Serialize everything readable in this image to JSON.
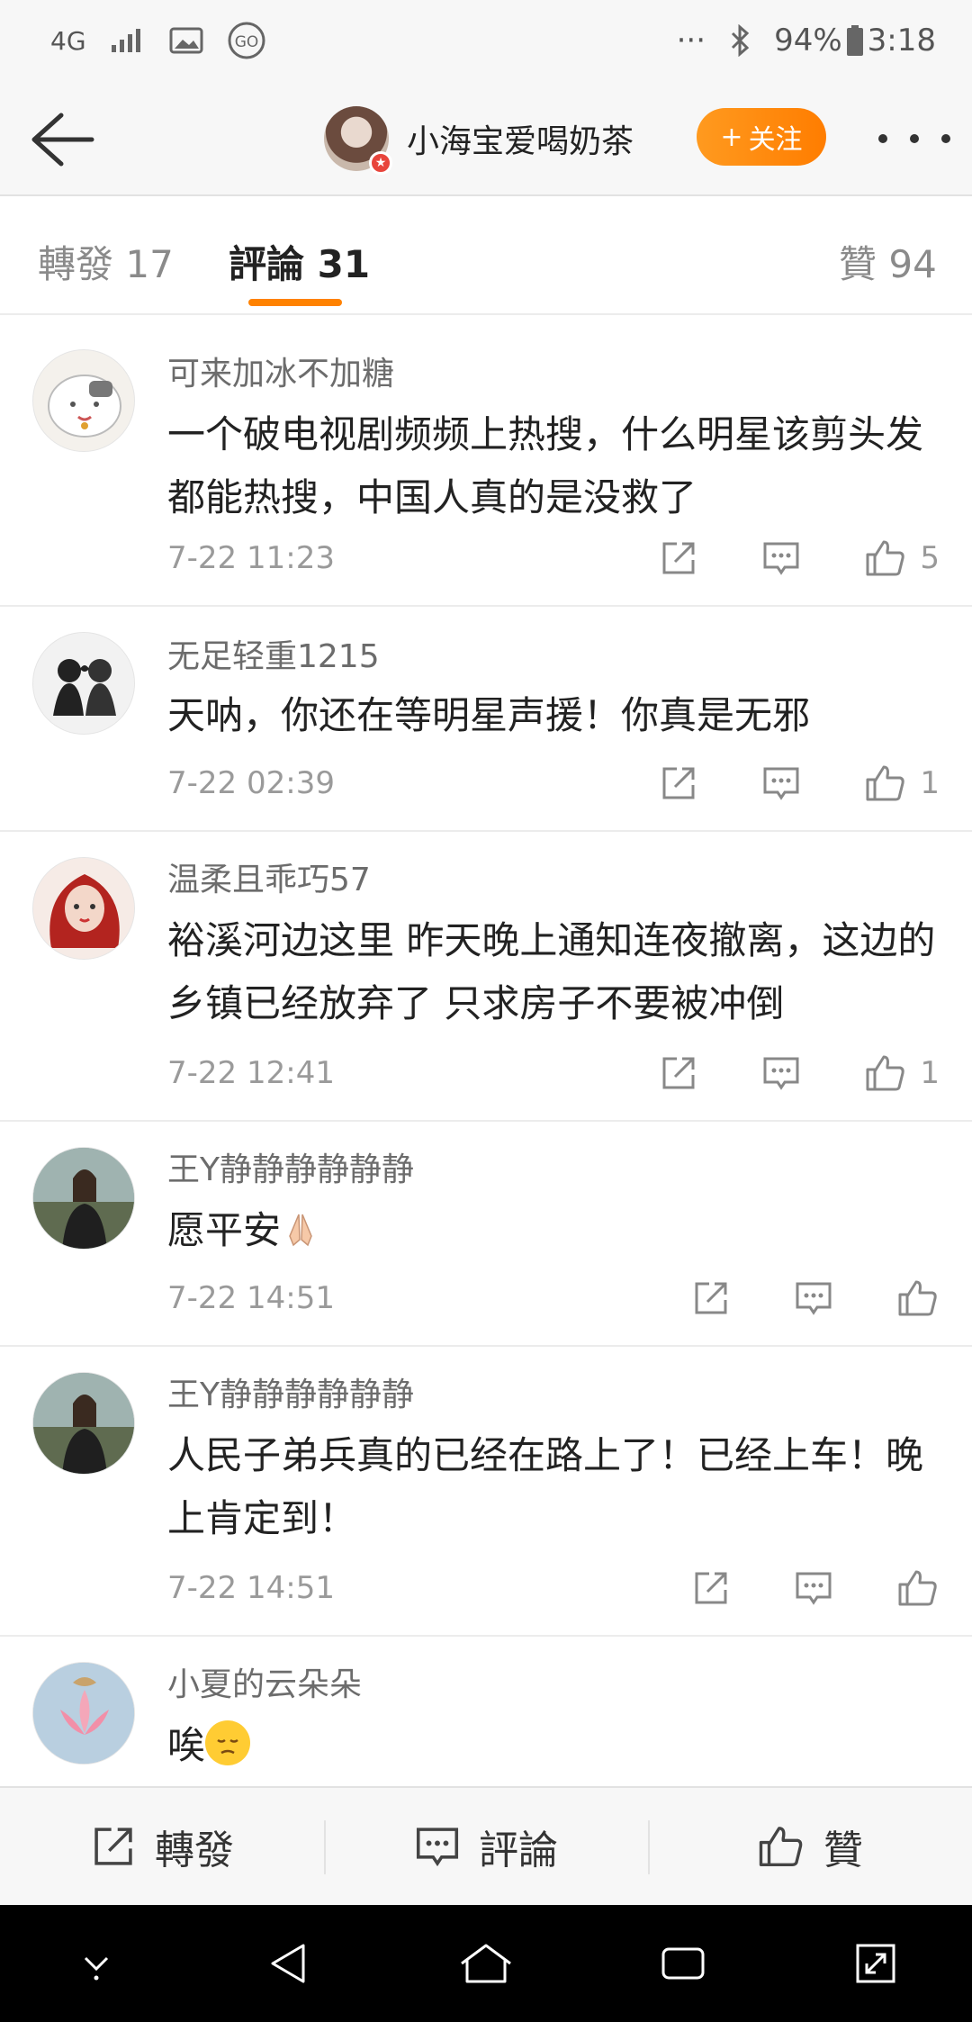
{
  "status_bar": {
    "network": "4G",
    "battery": "94%",
    "time": "3:18",
    "dots": "···"
  },
  "nav": {
    "username": "小海宝爱喝奶茶",
    "follow_label": "关注",
    "follow_plus": "+"
  },
  "tabs": [
    {
      "label": "轉發 17"
    },
    {
      "label": "評論 31"
    },
    {
      "label": "贊 94"
    }
  ],
  "comments": [
    {
      "user": "可来加冰不加糖",
      "text": "一个破电视剧频频上热搜，什么明星该剪头发都能热搜，中国人真的是没救了",
      "time": "7-22 11:23",
      "likes": "5"
    },
    {
      "user": "无足轻重1215",
      "text": "天呐，你还在等明星声援！你真是无邪",
      "time": "7-22 02:39",
      "likes": "1"
    },
    {
      "user": "温柔且乖巧57",
      "text": "裕溪河边这里 昨天晚上通知连夜撤离，这边的乡镇已经放弃了 只求房子不要被冲倒",
      "time": "7-22 12:41",
      "likes": "1"
    },
    {
      "user": "王Y静静静静静静",
      "text": "愿平安",
      "time": "7-22 14:51",
      "likes": ""
    },
    {
      "user": "王Y静静静静静静",
      "text": "人民子弟兵真的已经在路上了！已经上车！晚上肯定到！",
      "time": "7-22 14:51",
      "likes": ""
    },
    {
      "user": "小夏的云朵朵",
      "text": "唉",
      "time": "",
      "likes": ""
    }
  ],
  "bottom_bar": {
    "repost": "轉發",
    "comment": "評論",
    "like": "贊"
  },
  "colors": {
    "accent": "#ff8200",
    "text": "#222222",
    "muted": "#9a9a9a"
  }
}
